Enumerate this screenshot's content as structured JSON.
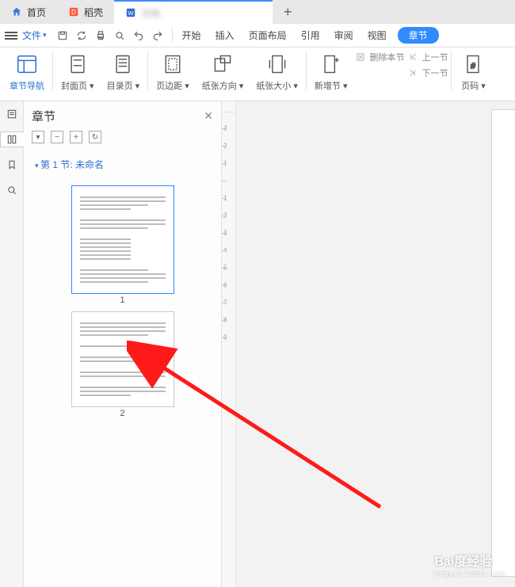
{
  "tabs": {
    "home": "首页",
    "daoke": "稻壳",
    "doc": "文档",
    "add": "+"
  },
  "menubar": {
    "file": "文件",
    "menus": [
      "开始",
      "插入",
      "页面布局",
      "引用",
      "审阅",
      "视图"
    ],
    "chapter": "章节"
  },
  "ribbon": {
    "nav": "章节导航",
    "cover": "封面页",
    "toc": "目录页",
    "margin": "页边距",
    "orient": "纸张方向",
    "size": "纸张大小",
    "newsec": "新增节",
    "delsec": "删除本节",
    "prevsec": "上一节",
    "nextsec": "下一节",
    "pagenum": "页码"
  },
  "panel": {
    "title": "章节",
    "tools": [
      "▾",
      "−",
      "+",
      "↻"
    ],
    "section": "第 1 节: 未命名",
    "pages": [
      "1",
      "2"
    ]
  },
  "ruler_ticks": [
    "3",
    "2",
    "1",
    "",
    "1",
    "2",
    "3",
    "4",
    "5",
    "6",
    "7",
    "8",
    "9"
  ],
  "watermark": {
    "brand": "Bai度经验",
    "sub": "jingyan.baidu.com"
  }
}
